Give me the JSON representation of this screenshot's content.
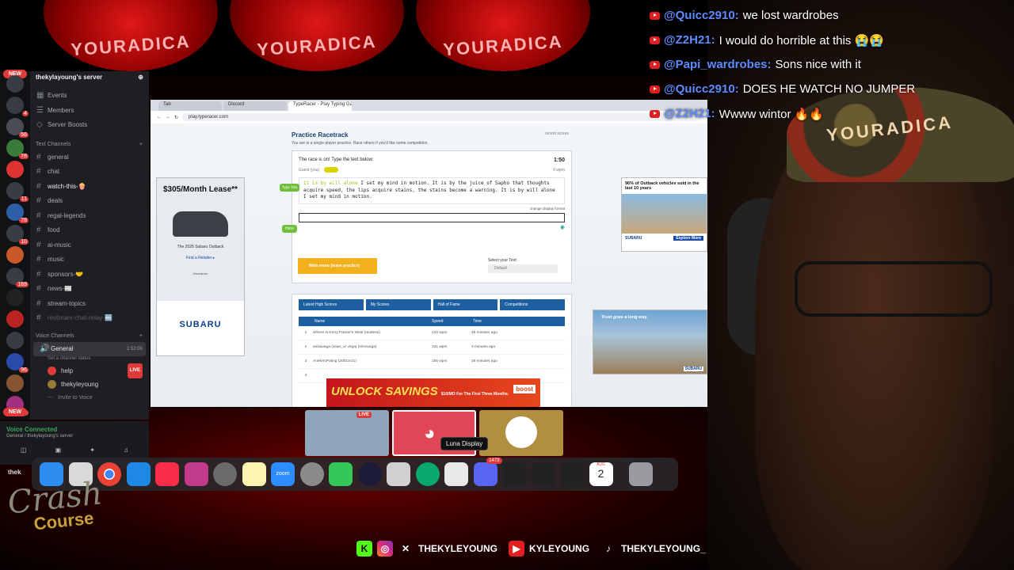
{
  "banner": {
    "text": "YOURADICA"
  },
  "discord": {
    "server_name": "thekylayoung's server",
    "top_items": [
      {
        "label": "Events"
      },
      {
        "label": "Members"
      },
      {
        "label": "Server Boosts"
      }
    ],
    "text_category": "Text Channels",
    "channels": [
      {
        "name": "general"
      },
      {
        "name": "chat"
      },
      {
        "name": "watch-this-🍿"
      },
      {
        "name": "deals"
      },
      {
        "name": "regal-legends"
      },
      {
        "name": "food"
      },
      {
        "name": "ai-music"
      },
      {
        "name": "music"
      },
      {
        "name": "sponsors-🤝"
      },
      {
        "name": "news-📰"
      },
      {
        "name": "stream-topics"
      },
      {
        "name": "restream-chat-relay-🔤"
      }
    ],
    "voice_category": "Voice Channels",
    "voice_channel": {
      "name": "General",
      "sub": "Set a channel status",
      "count": "1:52:00"
    },
    "voice_members": [
      {
        "name": "help",
        "live": "LIVE"
      },
      {
        "name": "thekyleyoung",
        "live": ""
      }
    ],
    "invite": "Invite to Voice",
    "server_badges": [
      "4",
      "56",
      "78",
      "11",
      "78",
      "10",
      "169",
      "96",
      "5"
    ],
    "new_label": "NEW",
    "voice_connected": "Voice Connected",
    "voice_connected_sub": "General / thekylayoung's server",
    "user_short": "thek"
  },
  "browser": {
    "tabs": [
      "TypeRacer - Play Typing Game",
      "Tab",
      "Discord"
    ],
    "url": "play.typeracer.com"
  },
  "typeracer": {
    "title": "Practice Racetrack",
    "subtitle": "You are in a single-player practice. Race others if you'd like some competition.",
    "race_on": "The race is on! Type the text below:",
    "timer": "1:50",
    "guest": "Guest (you)",
    "wpm": "0 wpm",
    "typed": "It is by will alone",
    "text": " I set my mind in motion. It is by the juice of Sapho that thoughts acquire speed, the lips acquire stains, the stains become a warning. It is by will alone I set my mind in motion.",
    "change_format": "change display format",
    "type_this": "Type This",
    "here": "Here",
    "main_menu": "Main menu (leave practice)",
    "select_text": "Select your Text:",
    "select_value": "Default",
    "recent_scores": "recent scores",
    "score_tabs": [
      "Latest High Scores",
      "My Scores",
      "Hall of Fame",
      "Competitions"
    ],
    "score_headers": [
      "Name",
      "Speed",
      "Time"
    ],
    "scores": [
      {
        "n": "1",
        "name": "Where is Kerry Packer's Weal (tuuttess)",
        "speed": "210 wpm",
        "time": "45 minutes ago"
      },
      {
        "n": "2",
        "name": "anisavaga (sean_or virga) (simovaga)",
        "speed": "161 wpm",
        "time": "3 minutes ago"
      },
      {
        "n": "3",
        "name": "AnekHuPaling (2001xr21)",
        "speed": "156 wpm",
        "time": "28 minutes ago"
      },
      {
        "n": "4",
        "name": "",
        "speed": "",
        "time": ""
      }
    ]
  },
  "ads": {
    "left_price": "$305/Month Lease**",
    "left_model": "The 2026 Subaru Outback",
    "left_retailer": "Find a Retailer ▸",
    "left_disclaimer": "Disclaimer",
    "left_logo": "SUBARU",
    "right1_text": "96% of Outback vehicles sold in the last 10 years",
    "right1_logo": "SUBARU",
    "right1_cta": "Explore More",
    "right2_text": "Trust goes a long way.",
    "right2_logo": "SUBARU",
    "boost_text": "UNLOCK SAVINGS",
    "boost_sub": "$10/MO For The First Three Months.",
    "boost_logo": "boost"
  },
  "tooltip": "Luna Display",
  "dock": {
    "discord_badge": "1473",
    "calendar_month": "AUG",
    "calendar_day": "2",
    "zoom_label": "zoom"
  },
  "overlay": {
    "logo": "Crash",
    "logo_sub": "Course",
    "handle_x": "THEKYLEYOUNG",
    "handle_yt": "KYLEYOUNG",
    "handle_tiktok": "THEKYLEYOUNG_"
  },
  "webcam": {
    "cap_text": "YOURADICA"
  },
  "chat": [
    {
      "user": "@Quicc2910",
      "text": "we lost wardrobes"
    },
    {
      "user": "@Z2H21",
      "text": "I would do horrible at this 😭😭"
    },
    {
      "user": "@Papi_wardrobes",
      "text": "Sons nice with it"
    },
    {
      "user": "@Quicc2910",
      "text": "DOES HE WATCH NO JUMPER"
    },
    {
      "user": "@Z2H21",
      "text": "Wwww wintor 🔥🔥"
    }
  ],
  "colors": {
    "discord_bg": "#1e1f22",
    "typeracer_blue": "#1d5fa0",
    "yt_red": "#e02020",
    "chat_user": "#5e8cff"
  }
}
